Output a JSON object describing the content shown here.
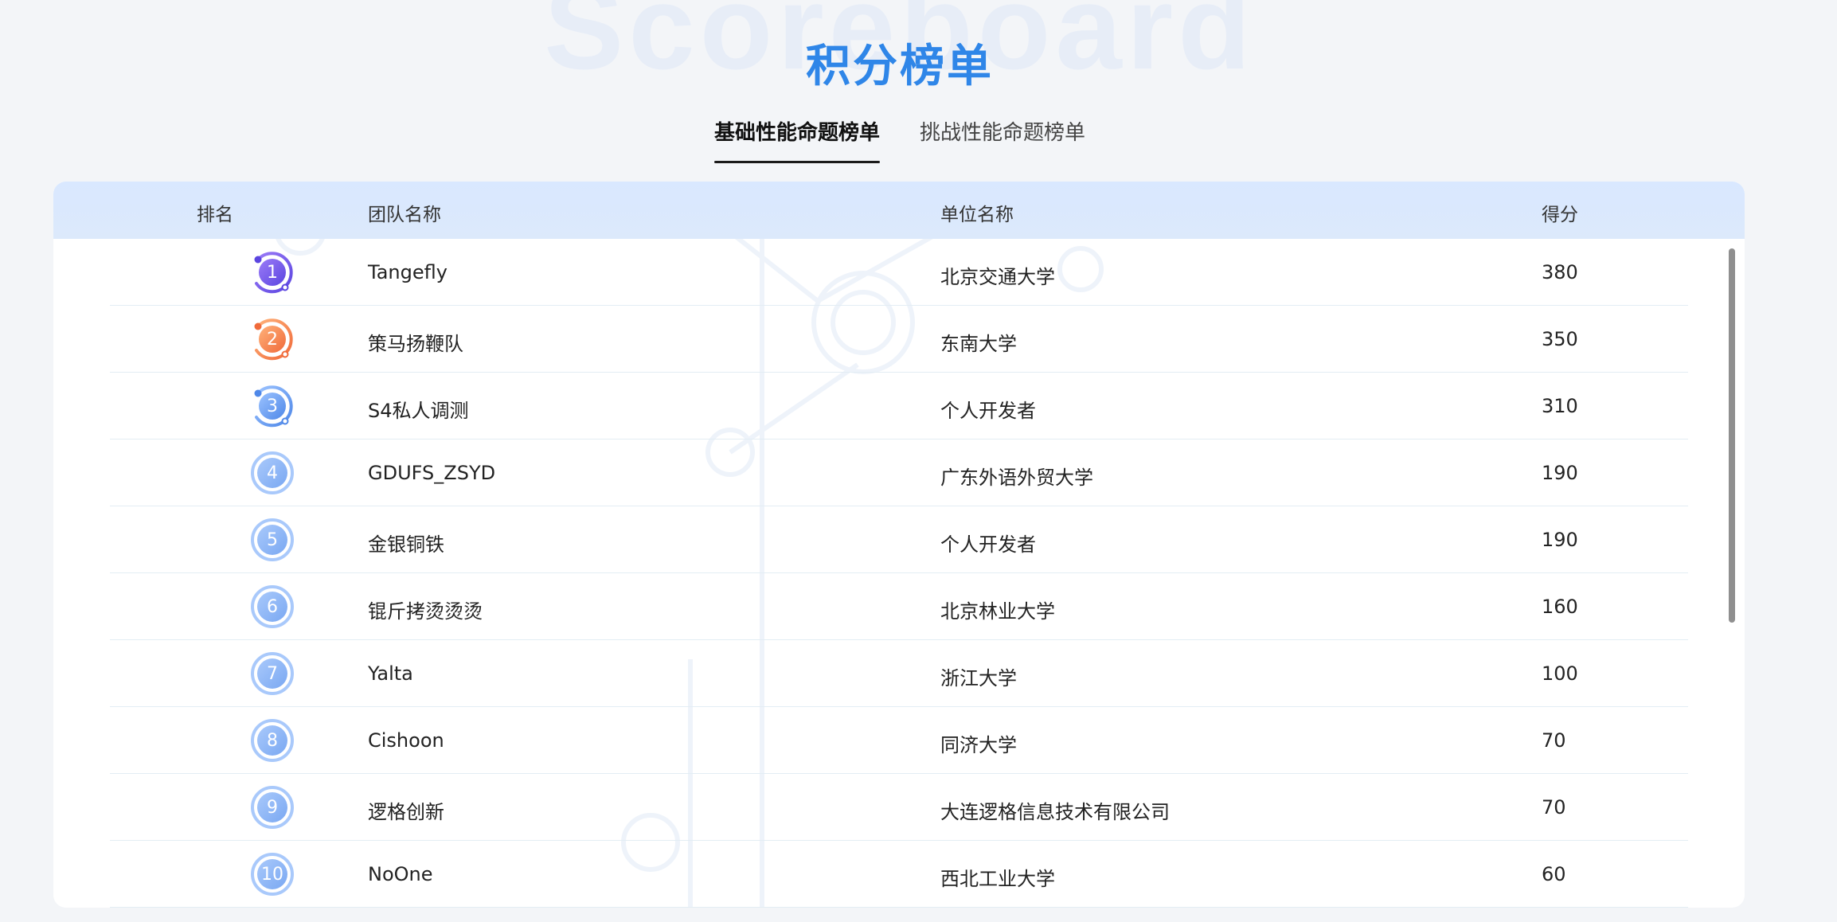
{
  "header": {
    "bg_word": "Scoreboard",
    "title": "积分榜单"
  },
  "tabs": [
    {
      "label": "基础性能命题榜单",
      "active": true
    },
    {
      "label": "挑战性能命题榜单",
      "active": false
    }
  ],
  "table": {
    "columns": [
      "排名",
      "团队名称",
      "单位名称",
      "得分"
    ],
    "rows": [
      {
        "rank": "1",
        "team": "Tangefly",
        "org": "北京交通大学",
        "score": "380",
        "badge": "purple"
      },
      {
        "rank": "2",
        "team": "策马扬鞭队",
        "org": "东南大学",
        "score": "350",
        "badge": "orange"
      },
      {
        "rank": "3",
        "team": "S4私人调测",
        "org": "个人开发者",
        "score": "310",
        "badge": "blue"
      },
      {
        "rank": "4",
        "team": "GDUFS_ZSYD",
        "org": "广东外语外贸大学",
        "score": "190",
        "badge": "plain"
      },
      {
        "rank": "5",
        "team": "金银铜铁",
        "org": "个人开发者",
        "score": "190",
        "badge": "plain"
      },
      {
        "rank": "6",
        "team": "锟斤拷烫烫烫",
        "org": "北京林业大学",
        "score": "160",
        "badge": "plain"
      },
      {
        "rank": "7",
        "team": "Yalta",
        "org": "浙江大学",
        "score": "100",
        "badge": "plain"
      },
      {
        "rank": "8",
        "team": "Cishoon",
        "org": "同济大学",
        "score": "70",
        "badge": "plain"
      },
      {
        "rank": "9",
        "team": "逻格创新",
        "org": "大连逻格信息技术有限公司",
        "score": "70",
        "badge": "plain"
      },
      {
        "rank": "10",
        "team": "NoOne",
        "org": "西北工业大学",
        "score": "60",
        "badge": "plain"
      }
    ]
  },
  "colors": {
    "title": "#2f86e8",
    "header_bg": "#d9e8ff",
    "badge_purple": [
      "#9b7bf7",
      "#5b45e0"
    ],
    "badge_orange": [
      "#ffb27a",
      "#f06a3a"
    ],
    "badge_blue": [
      "#9cc3ff",
      "#4f88e8"
    ],
    "badge_plain": [
      "#a9c9fb",
      "#7aa8f2"
    ]
  }
}
